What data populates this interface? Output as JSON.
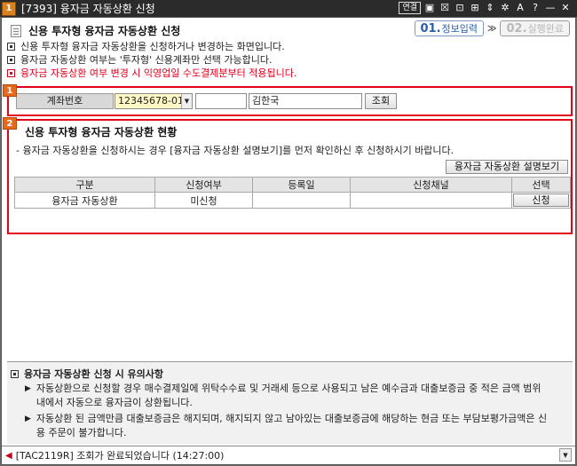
{
  "window": {
    "number": "1",
    "title": "[7393] 융자금 자동상환 신청",
    "title_controls": [
      "연결",
      "▣",
      "☒",
      "⊡",
      "⊞",
      "⇕",
      "✲",
      "A",
      "?",
      "—",
      "✕"
    ]
  },
  "header": {
    "title": "신용 투자형 융자금 자동상환 신청",
    "steps": [
      {
        "num": "01.",
        "label": "정보입력"
      },
      {
        "num": "02.",
        "label": "실행완료"
      }
    ],
    "step_arrow": "≫"
  },
  "notes": [
    "신용 투자형 융자금 자동상환을 신청하거나 변경하는 화면입니다.",
    "융자금 자동상환 여부는 '투자형' 신용계좌만 선택 가능합니다.",
    "융자금 자동상환 여부 변경 시 익영업일 수도결제분부터 적용됩니다."
  ],
  "account": {
    "badge": "1",
    "label": "계좌번호",
    "number": "12345678-01",
    "password": "",
    "name": "김한국",
    "query_button": "조회"
  },
  "section2": {
    "badge": "2",
    "title": "신용 투자형 융자금 자동상환 현황",
    "description": "- 융자금 자동상환을 신청하시는 경우 [융자금 자동상환 설명보기]를 먼저 확인하신 후 신청하시기 바랍니다.",
    "guide_button": "융자금 자동상환 설명보기",
    "table": {
      "headers": [
        "구분",
        "신청여부",
        "등록일",
        "신청채널",
        "선택"
      ],
      "rows": [
        {
          "type": "융자금 자동상환",
          "status": "미신청",
          "date": "",
          "channel": "",
          "action": "신청"
        }
      ]
    }
  },
  "caution": {
    "title": "융자금 자동상환 신청 시 유의사항",
    "items": [
      "자동상환으로 신청할 경우 매수결제일에 위탁수수료 및 거래세 등으로 사용되고 남은 예수금과 대출보증금 중 적은 금액 범위 내에서 자동으로 융자금이 상환됩니다.",
      "자동상환 된 금액만큼 대출보증금은 해지되며, 해지되지 않고 남아있는 대출보증금에 해당하는 현금 또는 부담보평가금액은 신용 주문이 불가합니다."
    ]
  },
  "status": {
    "text": "[TAC2119R] 조회가 완료되었습니다 (14:27:00)"
  }
}
